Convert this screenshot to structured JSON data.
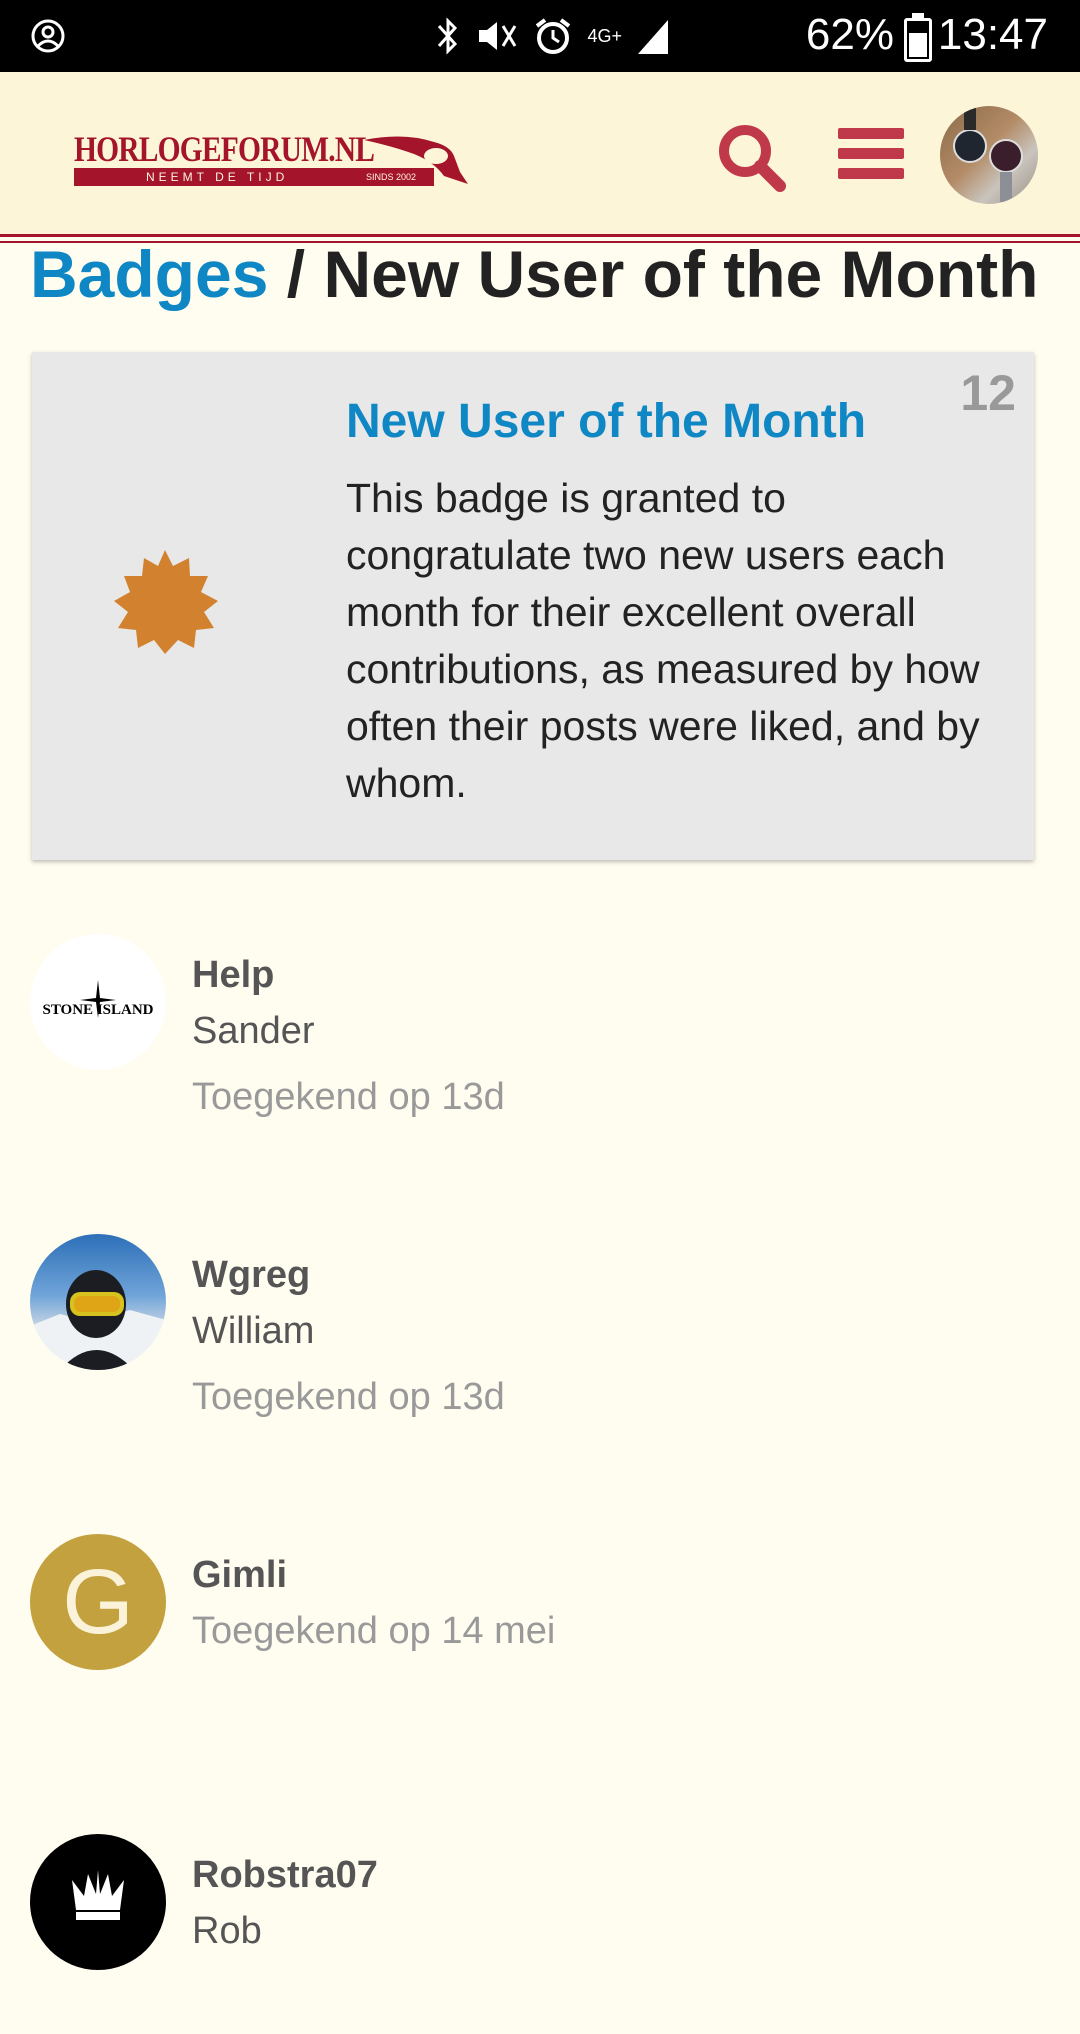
{
  "status_bar": {
    "battery": "62%",
    "time": "13:47",
    "network": "4G+",
    "icons": [
      "account-circle-icon",
      "bluetooth-icon",
      "vibrate-icon",
      "alarm-icon",
      "signal-icon",
      "battery-icon"
    ]
  },
  "header": {
    "logo_title": "HORLOGEFORUM.NL",
    "logo_tagline": "NEEMT DE TIJD",
    "logo_since": "SINDS 2002",
    "icons": [
      "search-icon",
      "hamburger-menu-icon",
      "user-avatar"
    ]
  },
  "breadcrumb": {
    "link": "Badges",
    "separator": "/",
    "current": "New User of the Month"
  },
  "badge": {
    "count": "12",
    "name": "New User of the Month",
    "description": "This badge is granted to congratulate two new users each month for their excellent overall contributions, as measured by how often their posts were liked, and by whom.",
    "icon": "certificate-icon",
    "icon_color": "#d2822f"
  },
  "users": [
    {
      "handle": "Help",
      "name": "Sander",
      "granted": "Toegekend op 13d",
      "avatar_text": "STONE ISLAND"
    },
    {
      "handle": "Wgreg",
      "name": "William",
      "granted": "Toegekend op 13d"
    },
    {
      "handle": "Gimli",
      "name": "",
      "granted": "Toegekend op 14 mei",
      "avatar_letter": "G"
    },
    {
      "handle": "Robstra07",
      "name": "Rob",
      "granted": ""
    }
  ],
  "colors": {
    "brand": "#a4152c",
    "accent_icons": "#c0394b",
    "link": "#0f87c4",
    "background": "#fffdf0",
    "header_bg": "#fdf5d8"
  }
}
